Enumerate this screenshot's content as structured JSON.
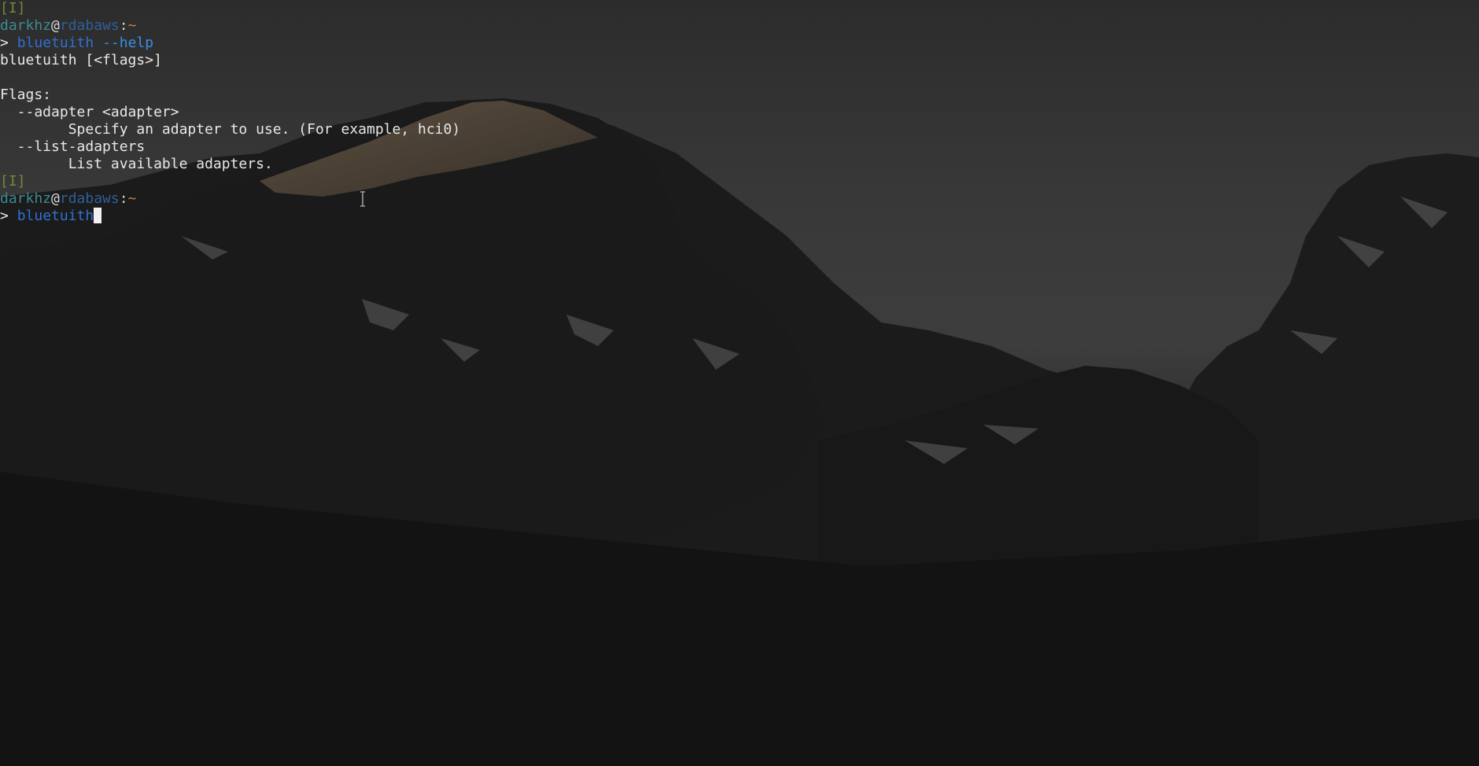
{
  "terminal": {
    "block1": {
      "mode": "[I]",
      "user": "darkhz",
      "at": "@",
      "host": "rdabaws",
      "colon": ":",
      "dir": "~",
      "arrow": ">",
      "command": "bluetuith",
      "args": "--help"
    },
    "output": {
      "usage": "bluetuith [<flags>]",
      "flags_header": "Flags:",
      "flag1_name": "  --adapter <adapter>",
      "flag1_desc": "        Specify an adapter to use. (For example, hci0)",
      "flag2_name": "  --list-adapters",
      "flag2_desc": "        List available adapters."
    },
    "block2": {
      "mode": "[I]",
      "user": "darkhz",
      "at": "@",
      "host": "rdabaws",
      "colon": ":",
      "dir": "~",
      "arrow": ">",
      "command": "bluetuith"
    }
  },
  "colors": {
    "mode": "#6e8a3a",
    "user": "#3c8a93",
    "host": "#2f5f9a",
    "dir": "#b88a3a",
    "command": "#2d72d2",
    "text": "#e8e8e8"
  },
  "icons": {
    "mouse_cursor": "text-ibeam-cursor"
  }
}
